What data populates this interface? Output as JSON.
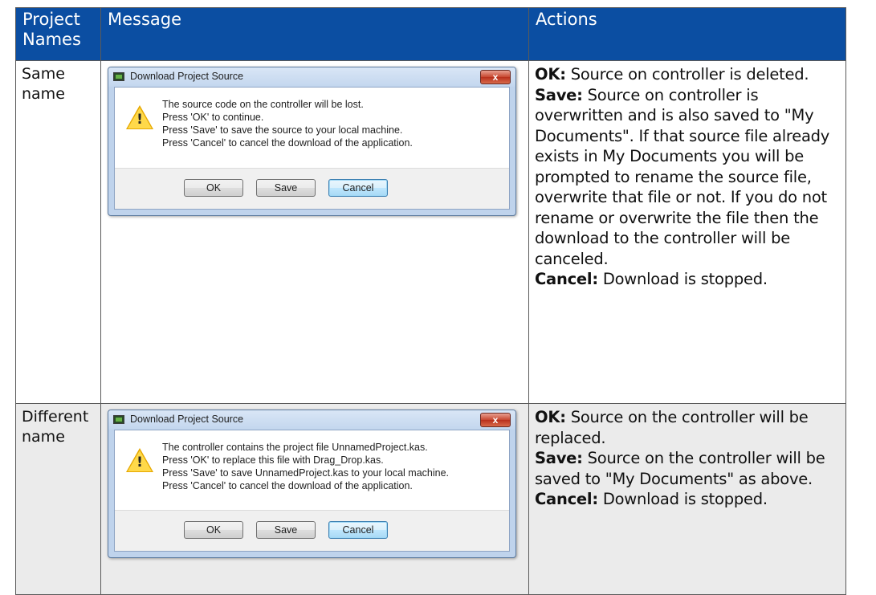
{
  "table": {
    "headers": {
      "names": "Project Names",
      "message": "Message",
      "actions": "Actions"
    },
    "rows": [
      {
        "name": "Same name",
        "dialog": {
          "title": "Download Project Source",
          "close_glyph": "x",
          "icon": "warning-icon",
          "lines": [
            "The source code on the controller will be lost.",
            "Press 'OK' to continue.",
            "Press 'Save' to save the source to your local machine.",
            "Press 'Cancel' to cancel the download of the application."
          ],
          "buttons": {
            "ok": "OK",
            "save": "Save",
            "cancel": "Cancel"
          }
        },
        "actions": [
          {
            "label": "OK:",
            "text": " Source on controller is deleted."
          },
          {
            "label": "Save:",
            "text": " Source on controller is overwritten and is also saved to \"My Documents\". If that source file already exists in My Documents you will be prompted to rename the source file, overwrite that file or not. If you do not rename or overwrite the file then the download to the controller will be canceled."
          },
          {
            "label": "Cancel:",
            "text": " Download is stopped."
          }
        ]
      },
      {
        "name": "Different name",
        "dialog": {
          "title": "Download Project Source",
          "close_glyph": "x",
          "icon": "warning-icon",
          "lines": [
            "The controller contains the project file UnnamedProject.kas.",
            "Press 'OK' to replace this file with Drag_Drop.kas.",
            "Press 'Save' to save UnnamedProject.kas to your local machine.",
            "Press 'Cancel' to cancel the download of the application."
          ],
          "buttons": {
            "ok": "OK",
            "save": "Save",
            "cancel": "Cancel"
          }
        },
        "actions": [
          {
            "label": "OK:",
            "text": " Source on the controller will be replaced."
          },
          {
            "label": "Save:",
            "text": " Source on the controller will be saved to \"My Documents\" as above."
          },
          {
            "label": "Cancel:",
            "text": " Download is stopped."
          }
        ]
      }
    ]
  },
  "colors": {
    "header_bg": "#0b4ea2",
    "row_alt_bg": "#ebebeb",
    "warning": "#ffd94a",
    "close_button": "#c7462f"
  }
}
